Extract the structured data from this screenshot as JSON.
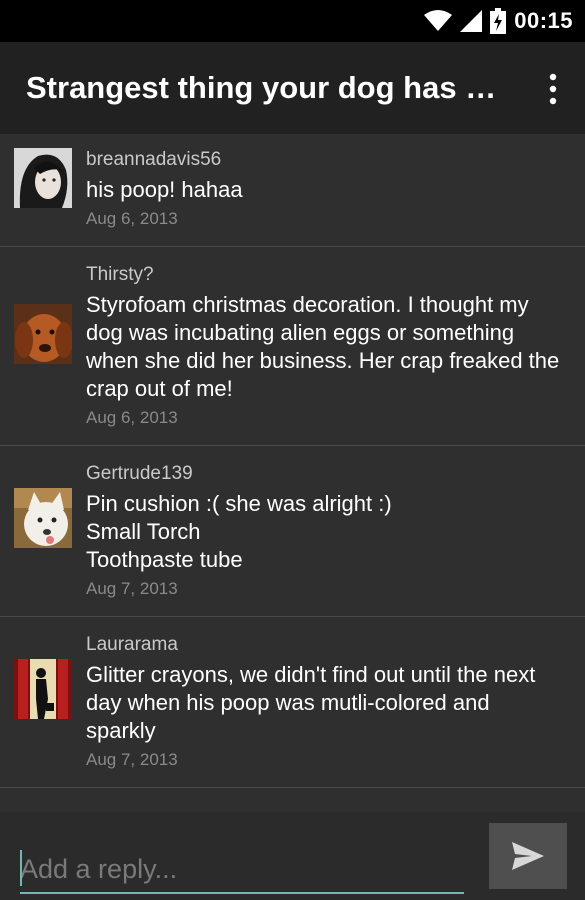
{
  "status_bar": {
    "time": "00:15",
    "icons": [
      "wifi-icon",
      "signal-icon",
      "battery-icon"
    ]
  },
  "app_bar": {
    "title": "Strangest thing your dog has e...",
    "menu_icon": "more-vert-icon"
  },
  "comments": [
    {
      "user": "breannadavis56",
      "text": "his poop! hahaa",
      "date": "Aug 6, 2013",
      "avatar": "avatar-woman"
    },
    {
      "user": "Thirsty?",
      "text": "Styrofoam christmas decoration. I thought my dog was incubating alien eggs or something when she did her business. Her crap freaked the crap out of me!",
      "date": "Aug 6, 2013",
      "avatar": "avatar-brown-dog"
    },
    {
      "user": "Gertrude139",
      "text": "Pin cushion :( she was alright :)\nSmall Torch\nToothpaste tube",
      "date": "Aug 7, 2013",
      "avatar": "avatar-white-dog"
    },
    {
      "user": "Laurarama",
      "text": "Glitter crayons, we didn't find out until the next day when his poop was mutli-colored and sparkly",
      "date": "Aug 7, 2013",
      "avatar": "avatar-silhouette"
    }
  ],
  "composer": {
    "placeholder": "Add a reply...",
    "send_icon": "send-icon"
  },
  "colors": {
    "accent": "#6fb9b2",
    "background": "#2f2f2f",
    "appbar": "#212121"
  }
}
